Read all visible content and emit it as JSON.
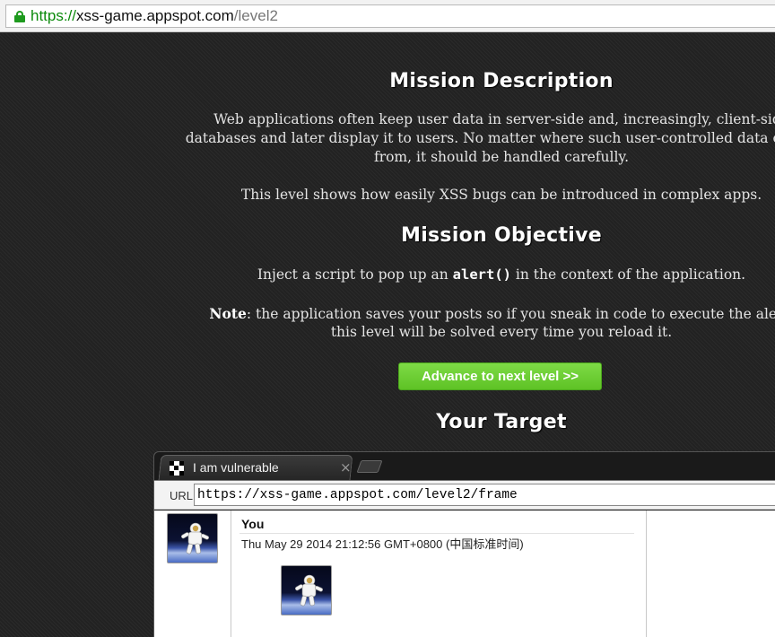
{
  "browser": {
    "url_scheme": "https://",
    "url_host": "xss-game.appspot.com",
    "url_path": "/level2"
  },
  "mission": {
    "description_heading": "Mission Description",
    "description_lines": [
      "Web applications often keep user data in server-side and, increasingly, client-side",
      "databases and later display it to users. No matter where such user-controlled data comes",
      "from, it should be handled carefully."
    ],
    "description_line4": "This level shows how easily XSS bugs can be introduced in complex apps.",
    "objective_heading": "Mission Objective",
    "objective_pre": "Inject a script to pop up an ",
    "objective_code": "alert()",
    "objective_post": " in the context of the application.",
    "note_label": "Note",
    "note_line1_rest": ": the application saves your posts so if you sneak in code to execute the alert,",
    "note_line2": "this level will be solved every time you reload it.",
    "advance_button": "Advance to next level >>",
    "target_heading": "Your Target"
  },
  "frame": {
    "tab_title": "I am vulnerable",
    "tab_close": "×",
    "url_label": "URL",
    "url_value": "https://xss-game.appspot.com/level2/frame",
    "post": {
      "author": "You",
      "date": "Thu May 29 2014 21:12:56 GMT+0800 (中国标准时间)"
    }
  },
  "colors": {
    "advance_button": "#6ccf33",
    "secure_lock": "#1e9a1e"
  },
  "icons": [
    "lock-icon",
    "favicon-icon",
    "close-icon",
    "new-tab-icon",
    "astronaut-avatar-icon"
  ]
}
